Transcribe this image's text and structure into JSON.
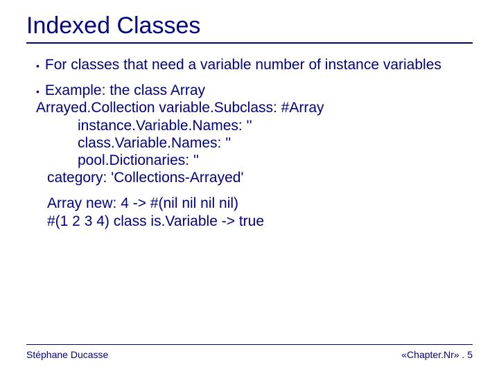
{
  "title": "Indexed Classes",
  "bullets": {
    "b1": "For classes that need a variable number of instance variables",
    "b2": "Example: the class Array"
  },
  "code": {
    "l1": "Arrayed.Collection variable.Subclass: #Array",
    "l2": "instance.Variable.Names: ''",
    "l3": "class.Variable.Names: ''",
    "l4": "pool.Dictionaries: ''",
    "l5": "category: 'Collections-Arrayed'",
    "l6": "Array new: 4 -> #(nil nil nil nil)",
    "l7": "#(1 2 3 4) class is.Variable -> true"
  },
  "footer": {
    "author": "Stéphane Ducasse",
    "page": "«Chapter.Nr» . 5"
  }
}
